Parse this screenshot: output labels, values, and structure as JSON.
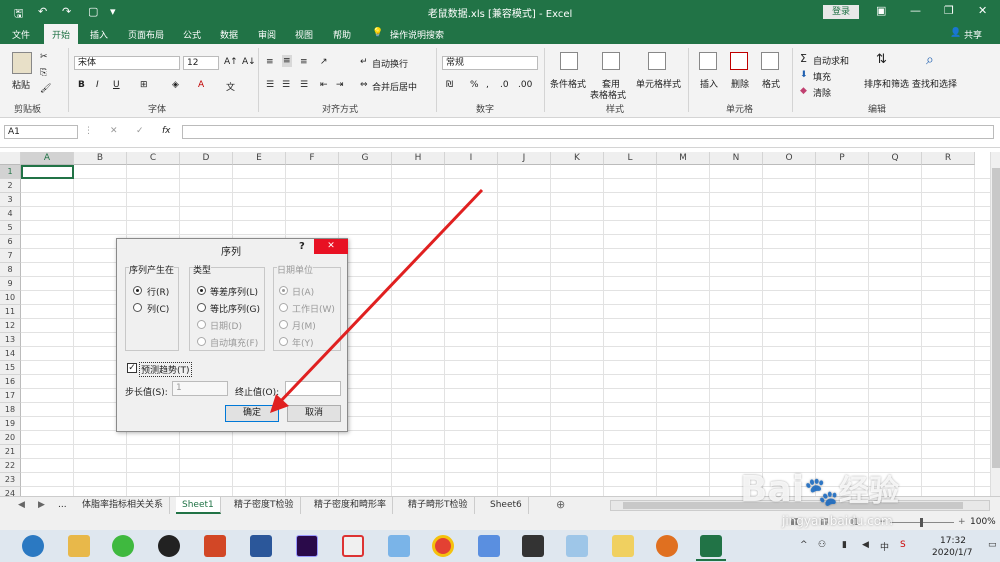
{
  "window": {
    "title": "老鼠数据.xls  [兼容模式]  -  Excel",
    "login_label": "登录"
  },
  "menu": {
    "tabs": [
      "文件",
      "开始",
      "插入",
      "页面布局",
      "公式",
      "数据",
      "审阅",
      "视图",
      "帮助"
    ],
    "search_label": "操作说明搜索",
    "share_label": "共享"
  },
  "ribbon": {
    "paste_label": "粘贴",
    "clipboard_group": "剪贴板",
    "font_name": "宋体",
    "font_size": "12",
    "font_group": "字体",
    "bold": "B",
    "italic": "I",
    "underline": "U",
    "wrap_label": "自动换行",
    "merge_label": "合并后居中",
    "align_group": "对齐方式",
    "number_format": "常规",
    "number_group": "数字",
    "cond_format": "条件格式",
    "table_format_1": "套用",
    "table_format_2": "表格格式",
    "cell_style": "单元格样式",
    "style_group": "样式",
    "insert_label": "插入",
    "delete_label": "删除",
    "format_label": "格式",
    "cells_group": "单元格",
    "autosum_label": "自动求和",
    "fill_label": "填充",
    "clear_label": "清除",
    "sort_label": "排序和筛选",
    "find_label": "查找和选择",
    "edit_group": "编辑"
  },
  "formula_bar": {
    "name_box": "A1",
    "fx": "fx",
    "value": ""
  },
  "grid": {
    "columns": [
      "A",
      "B",
      "C",
      "D",
      "E",
      "F",
      "G",
      "H",
      "I",
      "J",
      "K",
      "L",
      "M",
      "N",
      "O",
      "P",
      "Q",
      "R"
    ],
    "rows": [
      "1",
      "2",
      "3",
      "4",
      "5",
      "6",
      "7",
      "8",
      "9",
      "10",
      "11",
      "12",
      "13",
      "14",
      "15",
      "16",
      "17",
      "18",
      "19",
      "20",
      "21",
      "22",
      "23",
      "24"
    ]
  },
  "sheets": {
    "ellipsis": "...",
    "tabs": [
      "体脂率指标相关关系",
      "Sheet1",
      "精子密度T检验",
      "精子密度和畸形率",
      "精子畸形T检验",
      "Sheet6"
    ],
    "active": "Sheet1",
    "active_color": "#217346"
  },
  "status": {
    "zoom": "100%"
  },
  "taskbar": {
    "time": "17:32",
    "date": "2020/1/7"
  },
  "dialog": {
    "title": "序列",
    "help": "?",
    "series_in_label": "序列产生在",
    "series_in_options": [
      "行(R)",
      "列(C)"
    ],
    "type_label": "类型",
    "type_options": [
      "等差序列(L)",
      "等比序列(G)",
      "日期(D)",
      "自动填充(F)"
    ],
    "date_unit_label": "日期单位",
    "date_unit_options": [
      "日(A)",
      "工作日(W)",
      "月(M)",
      "年(Y)"
    ],
    "trend_label": "预测趋势(T)",
    "step_label": "步长值(S):",
    "step_value": "1",
    "stop_label": "终止值(O):",
    "stop_value": "",
    "ok_label": "确定",
    "cancel_label": "取消"
  },
  "watermark": {
    "line1": "Bai",
    "line2": "经验",
    "url": "jingyan.baidu.com"
  }
}
